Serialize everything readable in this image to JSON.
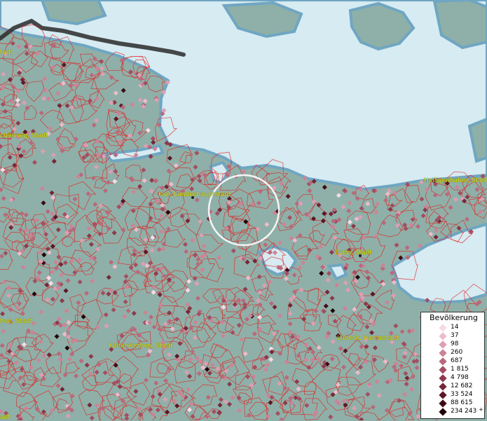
{
  "map": {
    "colors": {
      "land": "#8fb0a8",
      "water": "#d6ebf2",
      "shore": "#6fa6c2",
      "boundary": "#e02020",
      "label": "#e2e600"
    },
    "places": [
      {
        "id": "schleswig",
        "name": "chleswig, Stadt"
      },
      {
        "id": "kiel",
        "name": "Kiel, Landeshauptstadt"
      },
      {
        "id": "heiligenhafen",
        "name": "Heiligenhafen, Stadt"
      },
      {
        "id": "eutin",
        "name": "Eutin, Stadt"
      },
      {
        "id": "itzehoe",
        "name": "hoe, Stadt"
      },
      {
        "id": "kaltenkirchen",
        "name": "Kaltenkirchen, Stadt"
      },
      {
        "id": "luebeck",
        "name": "Lübeck, Hansestadt"
      },
      {
        "id": "topleft",
        "name": "tadt"
      },
      {
        "id": "bottomleft",
        "name": "adt"
      }
    ]
  },
  "legend": {
    "title": "Bevölkerung",
    "items": [
      {
        "label": "14",
        "color": "#f7dbe6"
      },
      {
        "label": "37",
        "color": "#edbccc"
      },
      {
        "label": "98",
        "color": "#dd9fb3"
      },
      {
        "label": "260",
        "color": "#cc8497"
      },
      {
        "label": "687",
        "color": "#b86a7c"
      },
      {
        "label": "1 815",
        "color": "#a24f62"
      },
      {
        "label": "4 798",
        "color": "#8c3a4b"
      },
      {
        "label": "12 682",
        "color": "#742737"
      },
      {
        "label": "33 524",
        "color": "#5b1725"
      },
      {
        "label": "88 615",
        "color": "#3f0b16"
      },
      {
        "label": "234 243",
        "color": "#22040a"
      }
    ],
    "overflow_marker": "+"
  }
}
